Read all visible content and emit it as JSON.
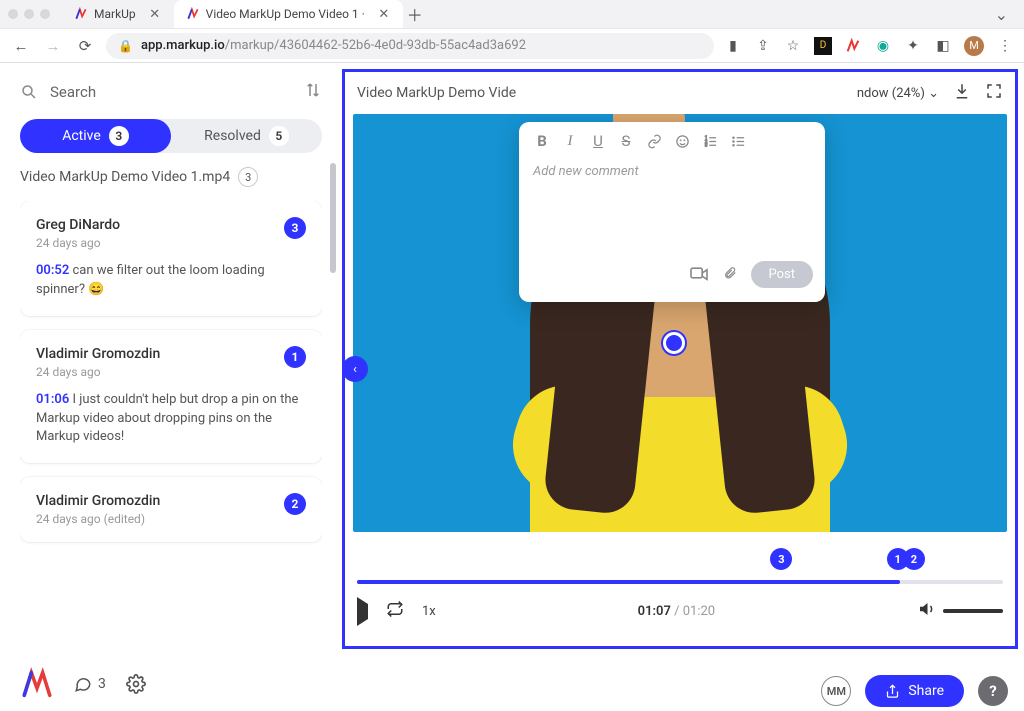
{
  "browser": {
    "tabs": [
      {
        "title": "MarkUp",
        "active": false
      },
      {
        "title": "Video MarkUp Demo Video 1 ·",
        "active": true
      }
    ],
    "url_host": "app.markup.io",
    "url_path": "/markup/43604462-52b6-4e0d-93db-55ac4ad3a692",
    "expand_indicator": "⌄"
  },
  "sidebar": {
    "search_placeholder": "Search",
    "tabs": {
      "active_label": "Active",
      "active_count": "3",
      "resolved_label": "Resolved",
      "resolved_count": "5"
    },
    "file": {
      "name": "Video MarkUp Demo Video 1.mp4",
      "count": "3"
    },
    "comments": [
      {
        "author": "Greg DiNardo",
        "time": "24 days ago",
        "pin": "3",
        "timestamp": "00:52",
        "body": "can we filter out the loom loading spinner? 😄"
      },
      {
        "author": "Vladimir Gromozdin",
        "time": "24 days ago",
        "pin": "1",
        "timestamp": "01:06",
        "body": "I just couldn't help but drop a pin on the Markup video about dropping pins on the Markup videos!"
      },
      {
        "author": "Vladimir Gromozdin",
        "time": "24 days ago (edited)",
        "pin": "2",
        "timestamp": "",
        "body": ""
      }
    ],
    "footer_comments": "3"
  },
  "main": {
    "title": "Video MarkUp Demo Vide",
    "fit_label": "ndow (24%)",
    "popup": {
      "placeholder": "Add new comment",
      "post_label": "Post"
    },
    "timeline": {
      "pins": [
        {
          "label": "3",
          "left_pct": 64
        },
        {
          "label": "1",
          "left_pct": 82
        },
        {
          "label": "2",
          "left_pct": 84.5
        }
      ],
      "progress_pct": 84
    },
    "controls": {
      "speed": "1x",
      "current": "01:07",
      "duration": "01:20"
    }
  },
  "bottom": {
    "initials": "MM",
    "share_label": "Share"
  }
}
